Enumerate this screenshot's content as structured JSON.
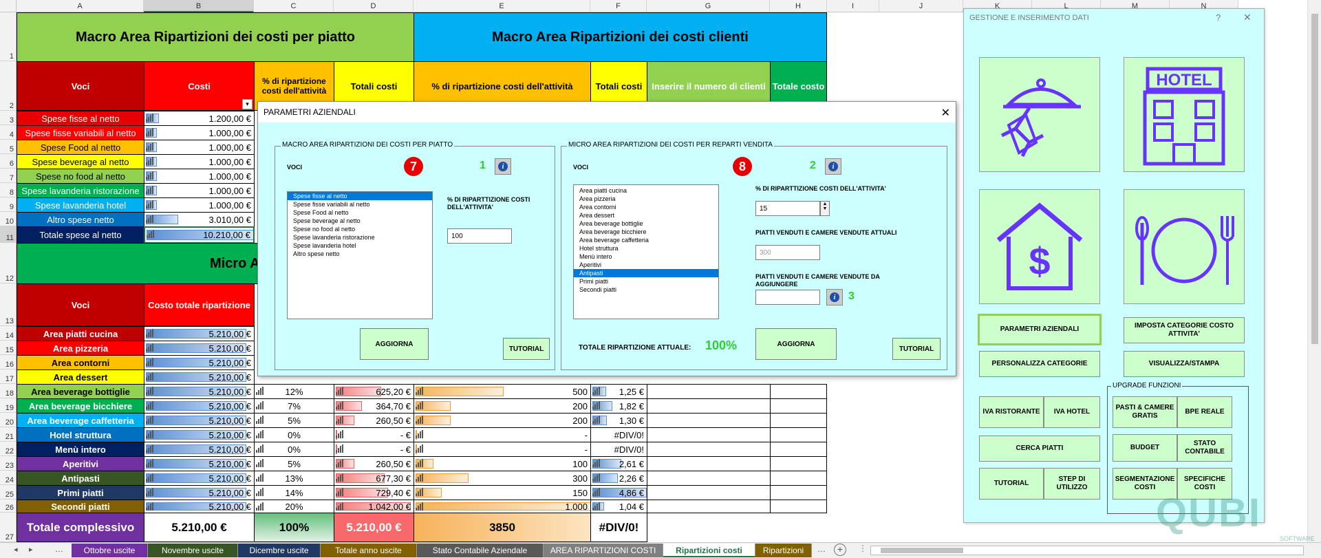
{
  "columns": [
    "A",
    "B",
    "C",
    "D",
    "E",
    "F",
    "G",
    "H",
    "I",
    "J",
    "K",
    "L",
    "M",
    "N"
  ],
  "rows": [
    "1",
    "2",
    "3",
    "4",
    "5",
    "6",
    "7",
    "8",
    "9",
    "10",
    "11",
    "12",
    "13",
    "14",
    "15",
    "16",
    "17",
    "18",
    "19",
    "20",
    "21",
    "22",
    "23",
    "24",
    "25",
    "26",
    "27"
  ],
  "header": {
    "macro_piatto": "Macro Area Ripartizioni dei costi per piatto",
    "macro_clienti": "Macro Area Ripartizioni dei costi clienti",
    "voci": "Voci",
    "costi": "Costi",
    "perc_rip": "% di ripartizione costi dell'attività",
    "totali_costi": "Totali costi",
    "perc_rip_e": "% di ripartizione costi dell'attività",
    "totali_costi_f": "Totali costi",
    "inserire_clienti": "Inserire il numero di clienti",
    "totale_costo": "Totale costo",
    "micro": "Micro A",
    "voci2": "Voci",
    "costo_totale_rip": "Costo totale ripartizione"
  },
  "spese": [
    {
      "label": "Spese fisse al netto",
      "value": "1.200,00 €",
      "color": "#e60000"
    },
    {
      "label": "Spese fisse variabili al netto",
      "value": "1.000,00 €",
      "color": "#ff0000"
    },
    {
      "label": "Spese Food al netto",
      "value": "1.000,00 €",
      "color": "#ffc000"
    },
    {
      "label": "Spese beverage al netto",
      "value": "1.000,00 €",
      "color": "#ffff00"
    },
    {
      "label": "Spese no food al netto",
      "value": "1.000,00 €",
      "color": "#92d050"
    },
    {
      "label": "Spese lavanderia ristorazione",
      "value": "1.000,00 €",
      "color": "#00b050"
    },
    {
      "label": "Spese lavanderia hotel",
      "value": "1.000,00 €",
      "color": "#00b0f0"
    },
    {
      "label": "Altro spese netto",
      "value": "3.010,00 €",
      "color": "#0070c0"
    },
    {
      "label": "Totale spese al netto",
      "value": "10.210,00 €",
      "color": "#002060"
    }
  ],
  "aree": [
    {
      "label": "Area piatti cucina",
      "cost": "5.210,00 €",
      "color": "#c00000"
    },
    {
      "label": "Area pizzeria",
      "cost": "5.210,00 €",
      "color": "#ff0000"
    },
    {
      "label": "Area contorni",
      "cost": "5.210,00 €",
      "color": "#ffc000"
    },
    {
      "label": "Area dessert",
      "cost": "5.210,00 €",
      "color": "#ffff00"
    },
    {
      "label": "Area beverage bottiglie",
      "cost": "5.210,00 €",
      "pct": "12%",
      "tot": "625,20 €",
      "n": "500",
      "unit": "1,25 €",
      "color": "#92d050"
    },
    {
      "label": "Area beverage bicchiere",
      "cost": "5.210,00 €",
      "pct": "7%",
      "tot": "364,70 €",
      "n": "200",
      "unit": "1,82 €",
      "color": "#00b050"
    },
    {
      "label": "Area beverage caffetteria",
      "cost": "5.210,00 €",
      "pct": "5%",
      "tot": "260,50 €",
      "n": "200",
      "unit": "1,30 €",
      "color": "#00b0f0"
    },
    {
      "label": "Hotel struttura",
      "cost": "5.210,00 €",
      "pct": "0%",
      "tot": "-   €",
      "n": "-",
      "unit": "#DIV/0!",
      "color": "#0070c0"
    },
    {
      "label": "Menù intero",
      "cost": "5.210,00 €",
      "pct": "0%",
      "tot": "-   €",
      "n": "-",
      "unit": "#DIV/0!",
      "color": "#002060"
    },
    {
      "label": "Aperitivi",
      "cost": "5.210,00 €",
      "pct": "5%",
      "tot": "260,50 €",
      "n": "100",
      "unit": "2,61 €",
      "color": "#7030a0"
    },
    {
      "label": "Antipasti",
      "cost": "5.210,00 €",
      "pct": "13%",
      "tot": "677,30 €",
      "n": "300",
      "unit": "2,26 €",
      "color": "#375623"
    },
    {
      "label": "Primi piatti",
      "cost": "5.210,00 €",
      "pct": "14%",
      "tot": "729,40 €",
      "n": "150",
      "unit": "4,86 €",
      "color": "#203864"
    },
    {
      "label": "Secondi piatti",
      "cost": "5.210,00 €",
      "pct": "20%",
      "tot": "1.042,00 €",
      "n": "1.000",
      "unit": "1,04 €",
      "color": "#806000"
    }
  ],
  "totale": {
    "label": "Totale  complessivo",
    "cost": "5.210,00 €",
    "pct": "100%",
    "tot": "5.210,00 €",
    "n": "3850",
    "unit": "#DIV/0!"
  },
  "dialog": {
    "title": "PARAMETRI AZIENDALI",
    "close": "✕",
    "left_group": "MACRO AREA RIPARTIZIONI DEI COSTI PER PIATTO",
    "voci": "VOCI",
    "left_badge": "7",
    "left_step": "1",
    "left_items": [
      "Spese fisse al netto",
      "Spese fisse variabili al netto",
      "Spese Food al netto",
      "Spese beverage al netto",
      "Spese no food al netto",
      "Spese lavanderia ristorazione",
      "Spese lavanderia hotel",
      "Altro spese netto"
    ],
    "left_pct_label": "% DI RIPARTTIZIONE COSTI DELL'ATTIVITA'",
    "left_pct_value": "100",
    "left_update": "AGGIORNA",
    "left_tutorial": "TUTORIAL",
    "right_group": "MICRO AREA RIPARTIZIONI DEI COSTI PER REPARTI VENDITA",
    "right_voci": "VOCI",
    "right_badge": "8",
    "right_step": "2",
    "right_items": [
      "Area piatti cucina",
      "Area pizzeria",
      "Area contorni",
      "Area dessert",
      "Area beverage bottiglie",
      "Area beverage bicchiere",
      "Area beverage caffetteria",
      "Hotel struttura",
      "Menù intero",
      "Aperitivi",
      "Antipasti",
      "Primi piatti",
      "Secondi piatti"
    ],
    "right_pct_label": "% DI RIPARTTIZIONE COSTI DELL'ATTIVITA'",
    "right_pct_value": "15",
    "sold_label": "PIATTI VENDUTI E CAMERE VENDUTE ATTUALI",
    "sold_value": "300",
    "add_label": "PIATTI VENDUTI E CAMERE VENDUTE DA AGGIUNGERE",
    "add_value": "",
    "right_step3": "3",
    "total_label": "TOTALE RIPARTIZIONE ATTUALE:",
    "total_value": "100%",
    "right_update": "AGGIORNA",
    "right_tutorial": "TUTORIAL"
  },
  "panel": {
    "title": "GESTIONE E INSERIMENTO DATI",
    "help": "?",
    "close": "✕",
    "parametri": "PARAMETRI AZIENDALI",
    "imposta": "IMPOSTA CATEGORIE COSTO ATTIVITA'",
    "personalizza": "PERSONALIZZA CATEGORIE",
    "visualizza": "VISUALIZZA/STAMPA",
    "upgrade": "UPGRADE FUNZIONI",
    "iva_rist": "IVA RISTORANTE",
    "iva_hotel": "IVA HOTEL",
    "pasti": "PASTI & CAMERE GRATIS",
    "bpe": "BPE REALE",
    "cerca": "CERCA PIATTI",
    "budget": "BUDGET",
    "stato": "STATO CONTABILE",
    "tutorial": "TUTORIAL",
    "step": "STEP DI UTILIZZO",
    "segmentazione": "SEGMENTAZIONE COSTI",
    "specifiche": "SPECIFICHE COSTI",
    "hotel_sign": "HOTEL"
  },
  "tabs": [
    "Ottobre uscite",
    "Novembre uscite",
    "Dicembre uscite",
    "Totale anno uscite",
    "Stato Contabile Aziendale",
    "AREA RIPARTIZIONI COSTI",
    "Ripartizioni costi",
    "Ripartizioni"
  ],
  "tab_colors": [
    "#7030a0",
    "#375623",
    "#203864",
    "#806000",
    "#595959",
    "#808080",
    "#ffffff",
    "#806000"
  ],
  "watermark": {
    "brand": "QUBI",
    "sub": "SOFTWARE"
  }
}
